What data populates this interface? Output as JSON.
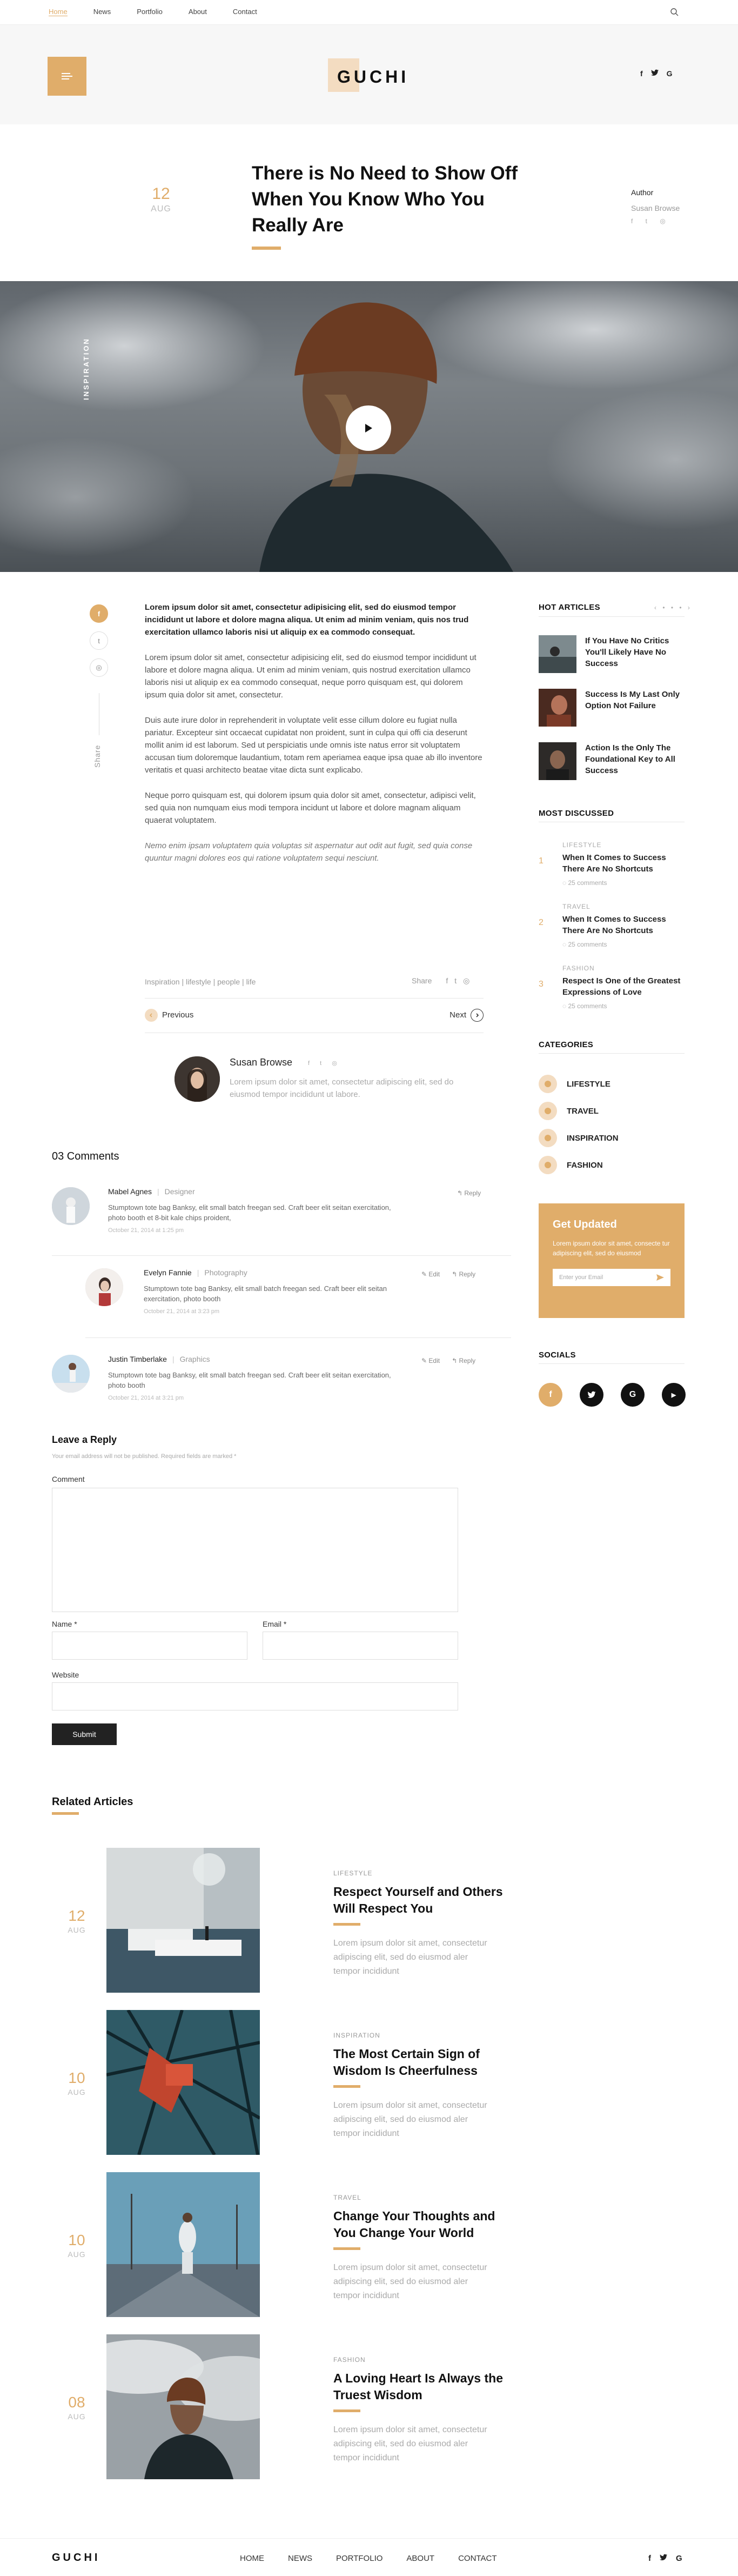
{
  "nav": {
    "items": [
      "Home",
      "News",
      "Portfolio",
      "About",
      "Contact"
    ],
    "active": 0
  },
  "brand": {
    "logo": "GUCHI"
  },
  "header_social": [
    "f",
    "t",
    "G"
  ],
  "article": {
    "day": "12",
    "month": "AUG",
    "title": "There is No Need to Show Off When You Know Who You Really Are",
    "author_label": "Author",
    "author_name": "Susan Browse",
    "author_social": "f t ◎",
    "category_label": "INSPIRATION",
    "lead": "Lorem ipsum dolor sit amet, consectetur adipisicing elit, sed do eiusmod tempor incididunt ut labore et dolore magna aliqua. Ut enim ad minim veniam, quis nos trud exercitation ullamco laboris nisi ut aliquip ex ea commodo consequat.",
    "p1": "Lorem ipsum dolor sit amet, consectetur adipisicing elit, sed do eiusmod tempor incididunt ut labore et dolore magna aliqua. Ut enim ad minim veniam, quis nostrud exercitation ullamco laboris nisi ut aliquip ex ea commodo consequat, neque porro quisquam est, qui dolorem ipsum quia dolor sit amet, consectetur.",
    "p2": "Duis aute irure dolor in reprehenderit in voluptate velit esse cillum dolore eu fugiat nulla pariatur. Excepteur sint occaecat cupidatat non proident, sunt in culpa qui offi cia deserunt mollit anim id est laborum. Sed ut perspiciatis unde omnis iste natus error sit voluptatem accusan tium doloremque laudantium, totam rem aperiamea eaque ipsa quae ab illo inventore veritatis et quasi architecto beatae vitae dicta sunt explicabo.",
    "p3": "Neque porro quisquam est, qui dolorem ipsum quia dolor sit amet, consectetur, adipisci velit, sed quia non numquam eius modi tempora incidunt ut labore et dolore magnam aliquam quaerat voluptatem.",
    "quote": "Nemo enim ipsam voluptatem quia voluptas sit aspernatur aut odit aut fugit, sed quia conse quuntur magni dolores eos qui ratione voluptatem sequi nesciunt.",
    "tags": "Inspiration | lifestyle | people | life",
    "share_label": "Share",
    "share_icons": [
      "f",
      "t",
      "◎"
    ],
    "prev": "Previous",
    "next": "Next",
    "share_vertical": "Share"
  },
  "author_box": {
    "name": "Susan Browse",
    "social": "f t ◎",
    "bio": "Lorem ipsum dolor sit amet, consectetur adipiscing elit, sed do eiusmod tempor incididunt ut labore."
  },
  "sidebar": {
    "hot_title": "HOT ARTICLES",
    "hot_nav": "‹ • • • ›",
    "hot": [
      "If You Have No Critics You'll Likely Have No Success",
      "Success Is My Last Only Option Not Failure",
      "Action Is the Only The Foundational Key to All Success"
    ],
    "most_title": "MOST DISCUSSED",
    "most": [
      {
        "n": "1",
        "cat": "LIFESTYLE",
        "title": "When It Comes to Success There Are No Shortcuts",
        "comments": "25 comments"
      },
      {
        "n": "2",
        "cat": "TRAVEL",
        "title": "When It Comes to Success There Are No Shortcuts",
        "comments": "25 comments"
      },
      {
        "n": "3",
        "cat": "FASHION",
        "title": "Respect Is One of the Greatest Expressions of Love",
        "comments": "25 comments"
      }
    ],
    "cat_title": "CATEGORIES",
    "cats": [
      "LIFESTYLE",
      "TRAVEL",
      "INSPIRATION",
      "FASHION"
    ],
    "newsletter_title": "Get Updated",
    "newsletter_text": "Lorem ipsum dolor sit amet, consecte tur adipiscing elit, sed do eiusmod",
    "newsletter_placeholder": "Enter your Email",
    "socials_title": "SOCIALS",
    "socials": [
      "f",
      "t",
      "G",
      "▶"
    ]
  },
  "comments": {
    "title": "03  Comments",
    "items": [
      {
        "name": "Mabel Agnes",
        "role": "Designer",
        "text": "Stumptown tote bag Banksy, elit small batch freegan sed. Craft beer elit seitan exercitation, photo booth et 8-bit kale chips proident,",
        "date": "October 21, 2014 at 1:25 pm",
        "edit": "",
        "reply": "Reply"
      },
      {
        "name": "Evelyn Fannie",
        "role": "Photography",
        "text": "Stumptown tote bag Banksy, elit small batch freegan sed. Craft beer elit seitan exercitation, photo booth",
        "date": "October 21, 2014 at 3:23 pm",
        "edit": "Edit",
        "reply": "Reply"
      },
      {
        "name": "Justin Timberlake",
        "role": "Graphics",
        "text": "Stumptown tote bag Banksy, elit small batch freegan sed. Craft beer elit seitan exercitation, photo booth",
        "date": "October 21, 2014 at 3:21 pm",
        "edit": "Edit",
        "reply": "Reply"
      }
    ]
  },
  "form": {
    "title": "Leave a Reply",
    "note": "Your email address will not be published. Required fields are marked *",
    "comment": "Comment",
    "name": "Name *",
    "email": "Email *",
    "website": "Website",
    "submit": "Submit"
  },
  "related": {
    "title": "Related Articles",
    "items": [
      {
        "day": "12",
        "month": "AUG",
        "cat": "LIFESTYLE",
        "title": "Respect Yourself and Others Will Respect You",
        "text": "Lorem ipsum dolor sit amet, consectetur adipiscing elit, sed do eiusmod aler tempor incididunt"
      },
      {
        "day": "10",
        "month": "AUG",
        "cat": "INSPIRATION",
        "title": "The Most Certain Sign of Wisdom Is Cheerfulness",
        "text": "Lorem ipsum dolor sit amet, consectetur adipiscing elit, sed do eiusmod aler tempor incididunt"
      },
      {
        "day": "10",
        "month": "AUG",
        "cat": "TRAVEL",
        "title": "Change Your Thoughts and You Change Your World",
        "text": "Lorem ipsum dolor sit amet, consectetur adipiscing elit, sed do eiusmod aler tempor incididunt"
      },
      {
        "day": "08",
        "month": "AUG",
        "cat": "FASHION",
        "title": "A Loving Heart Is Always the Truest Wisdom",
        "text": "Lorem ipsum dolor sit amet, consectetur adipiscing elit, sed do eiusmod aler tempor incididunt"
      }
    ]
  },
  "footer": {
    "logo": "GUCHI",
    "nav": [
      "HOME",
      "NEWS",
      "PORTFOLIO",
      "ABOUT",
      "CONTACT"
    ],
    "social": [
      "f",
      "t",
      "G"
    ]
  },
  "colors": {
    "accent": "#e0ad6a",
    "accent_light": "#f3dcc1",
    "dark": "#222222"
  }
}
